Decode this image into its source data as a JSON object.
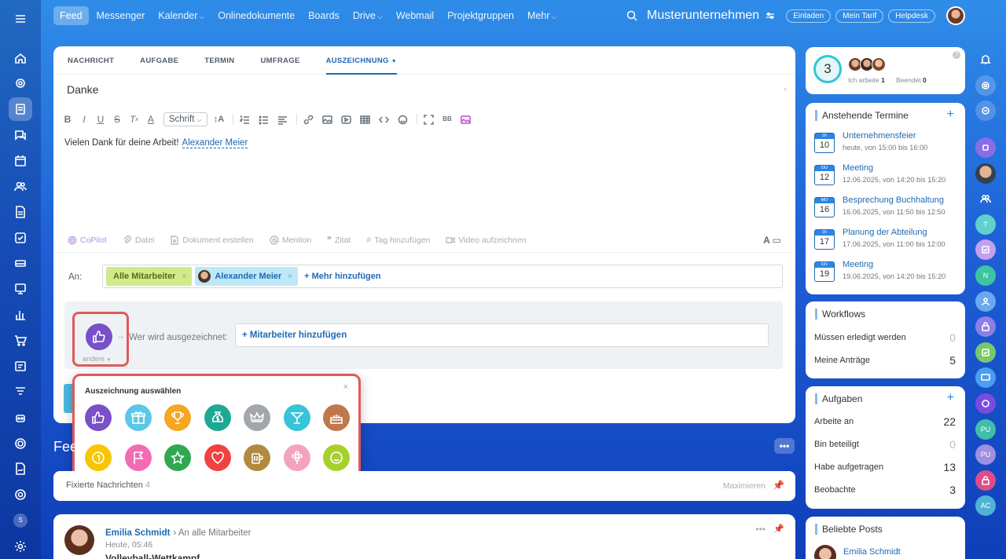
{
  "topnav": {
    "tabs": [
      {
        "label": "Feed",
        "active": true
      },
      {
        "label": "Messenger"
      },
      {
        "label": "Kalender",
        "caret": true
      },
      {
        "label": "Onlinedokumente"
      },
      {
        "label": "Boards"
      },
      {
        "label": "Drive",
        "caret": true
      },
      {
        "label": "Webmail"
      },
      {
        "label": "Projektgruppen"
      },
      {
        "label": "Mehr",
        "caret": true
      }
    ],
    "company": "Musterunternehmen",
    "buttons": [
      "Einladen",
      "Mein Tarif",
      "Helpdesk"
    ]
  },
  "composer": {
    "tabs": [
      "NACHRICHT",
      "AUFGABE",
      "TERMIN",
      "UMFRAGE",
      "AUSZEICHNUNG"
    ],
    "active_tab": "AUSZEICHNUNG",
    "title": "Danke",
    "close": "×",
    "font_select": "Schrift",
    "body_text": "Vielen Dank für deine Arbeit!",
    "mention": "Alexander Meier",
    "attachments": [
      "CoPilot",
      "Datei",
      "Dokument erstellen",
      "Mention",
      "Zitat",
      "Tag hinzufügen",
      "Video aufzeichnen"
    ],
    "recipient_label": "An:",
    "recipients": [
      "Alle Mitarbeiter",
      "Alexander Meier"
    ],
    "add_more": "+ Mehr hinzufügen",
    "badge_sub": "andere",
    "who_label": "Wer wird ausgezeichnet:",
    "add_employee": "+ Mitarbeiter hinzufügen"
  },
  "popup": {
    "title": "Auszeichnung auswählen",
    "close": "×",
    "badges": [
      {
        "icon": "thumbs-up-icon",
        "color": "#7850c8"
      },
      {
        "icon": "gift-icon",
        "color": "#5cc6e8"
      },
      {
        "icon": "trophy-icon",
        "color": "#f5a623"
      },
      {
        "icon": "money-bag-icon",
        "color": "#1ea896"
      },
      {
        "icon": "crown-icon",
        "color": "#a3a7ab"
      },
      {
        "icon": "cocktail-icon",
        "color": "#37c3d8"
      },
      {
        "icon": "cake-icon",
        "color": "#c0784a"
      },
      {
        "icon": "medal-icon",
        "color": "#f7c600"
      },
      {
        "icon": "flag-icon",
        "color": "#f26bb3"
      },
      {
        "icon": "star-icon",
        "color": "#2fa84f"
      },
      {
        "icon": "heart-icon",
        "color": "#ef4343"
      },
      {
        "icon": "beer-icon",
        "color": "#b18a3f"
      },
      {
        "icon": "flower-icon",
        "color": "#f3a3c0"
      },
      {
        "icon": "smile-icon",
        "color": "#a7d02c"
      }
    ]
  },
  "feed": {
    "heading": "Feed",
    "pinned_label": "Fixierte Nachrichten",
    "pinned_count": "4",
    "maximize": "Maximieren",
    "post": {
      "author": "Emilia Schmidt",
      "to": "An alle Mitarbeiter",
      "time": "Heute, 05:46",
      "title": "Volleyball-Wettkampf"
    }
  },
  "right": {
    "stat": {
      "count": "3",
      "working_label": "Ich arbeite",
      "working_val": "1",
      "done_label": "Beendet",
      "done_val": "0"
    },
    "events_title": "Anstehende Termine",
    "events": [
      {
        "day": "DI",
        "num": "10",
        "title": "Unternehmensfeier",
        "time": "heute, von 15:00 bis 16:00"
      },
      {
        "day": "DO",
        "num": "12",
        "title": "Meeting",
        "time": "12.06.2025, von 14:20 bis 15:20"
      },
      {
        "day": "MO",
        "num": "16",
        "title": "Besprechung Buchhaltung",
        "time": "16.06.2025, von 11:50 bis 12:50"
      },
      {
        "day": "DI",
        "num": "17",
        "title": "Planung der Abteilung",
        "time": "17.06.2025, von 11:00 bis 12:00"
      },
      {
        "day": "DO",
        "num": "19",
        "title": "Meeting",
        "time": "19.06.2025, von 14:20 bis 15:20"
      }
    ],
    "workflows_title": "Workflows",
    "workflows": [
      {
        "label": "Müssen erledigt werden",
        "value": "0"
      },
      {
        "label": "Meine Anträge",
        "value": "5"
      }
    ],
    "tasks_title": "Aufgaben",
    "tasks": [
      {
        "label": "Arbeite an",
        "value": "22"
      },
      {
        "label": "Bin beteiligt",
        "value": "0"
      },
      {
        "label": "Habe aufgetragen",
        "value": "13"
      },
      {
        "label": "Beobachte",
        "value": "3"
      }
    ],
    "posts_title": "Beliebte Posts",
    "posts_user": "Emilia Schmidt"
  },
  "rightbar": {
    "letters": [
      "T",
      "N",
      "PU",
      "PU",
      "AC"
    ]
  },
  "leftbar": {
    "user_initial": "S"
  }
}
